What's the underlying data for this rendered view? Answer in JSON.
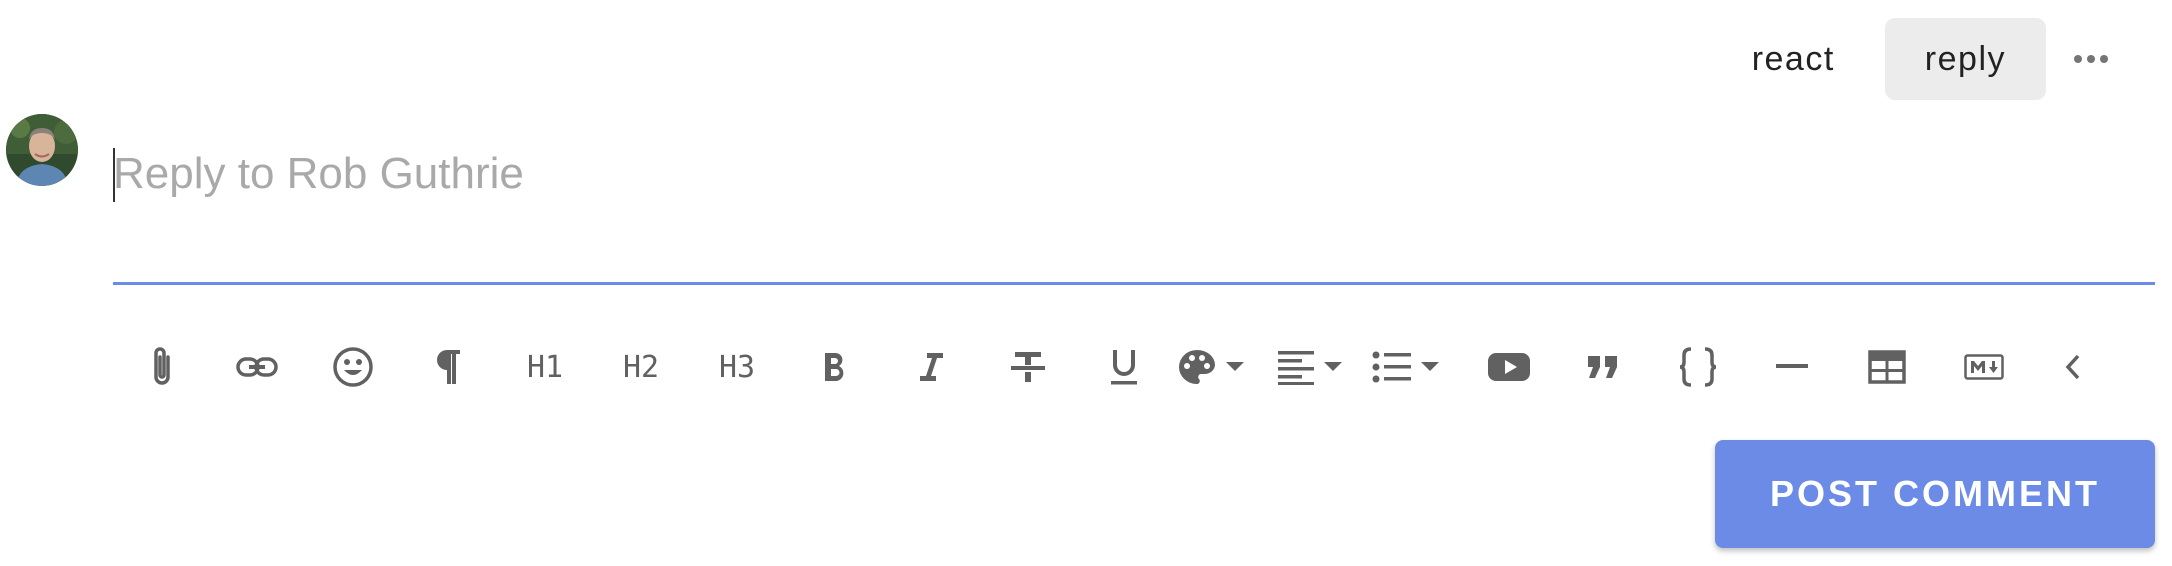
{
  "actions": {
    "react_label": "react",
    "reply_label": "reply",
    "more_icon": "more-horizontal-icon"
  },
  "composer": {
    "placeholder": "Reply to Rob Guthrie",
    "value": "",
    "avatar_icon": "user-avatar"
  },
  "toolbar": {
    "h1_label": "H1",
    "h2_label": "H2",
    "h3_label": "H3",
    "items": [
      "attach-icon",
      "link-icon",
      "emoji-icon",
      "paragraph-icon",
      "heading-1",
      "heading-2",
      "heading-3",
      "bold-icon",
      "italic-icon",
      "strikethrough-icon",
      "underline-icon",
      "text-color-icon",
      "align-icon",
      "list-icon",
      "youtube-icon",
      "quote-icon",
      "code-block-icon",
      "horizontal-rule-icon",
      "table-icon",
      "markdown-icon",
      "collapse-icon"
    ]
  },
  "post_button": {
    "label": "POST COMMENT"
  },
  "colors": {
    "accent": "#6b8be6",
    "icon": "#616161",
    "placeholder": "#a9a9a9"
  }
}
